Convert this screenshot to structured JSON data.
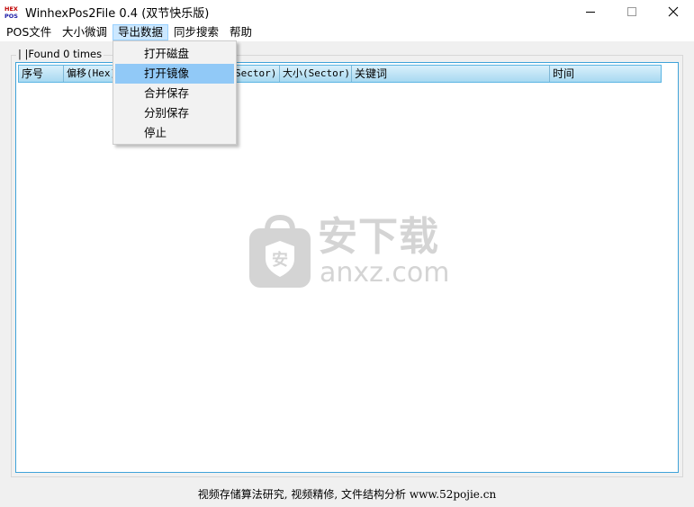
{
  "window": {
    "title": "WinhexPos2File  0.4  (双节快乐版)",
    "app_icon_text": [
      "HEX",
      "POS"
    ],
    "minimize_icon": "minimize-icon",
    "maximize_icon": "maximize-icon",
    "close_icon": "close-icon"
  },
  "menubar": {
    "items": [
      {
        "label": "POS文件"
      },
      {
        "label": "大小微调"
      },
      {
        "label": "导出数据",
        "active": true
      },
      {
        "label": "同步搜索"
      },
      {
        "label": "帮助"
      }
    ]
  },
  "dropdown": {
    "items": [
      {
        "label": "打开磁盘"
      },
      {
        "label": "打开镜像",
        "highlighted": true
      },
      {
        "label": "合并保存"
      },
      {
        "label": "分别保存"
      },
      {
        "label": "停止"
      }
    ]
  },
  "group": {
    "title": "| |Found 0 times"
  },
  "table": {
    "columns": [
      {
        "label": "序号"
      },
      {
        "label": "偏移(Hex)"
      },
      {
        "label": "Sector)"
      },
      {
        "label": "大小(Sector)"
      },
      {
        "label": "关键词"
      },
      {
        "label": "时间"
      }
    ],
    "rows": []
  },
  "watermark": {
    "text": "安下载",
    "url": "anxz.com"
  },
  "statusbar": {
    "text": "视频存储算法研究, 视频精修, 文件结构分析 www.52pojie.cn"
  },
  "colors": {
    "accent": "#3fa3d9",
    "header_top": "#d9f0fb",
    "header_bottom": "#a8d9f1",
    "menu_active": "#cce8ff",
    "dropdown_highlight": "#91c9f7"
  }
}
